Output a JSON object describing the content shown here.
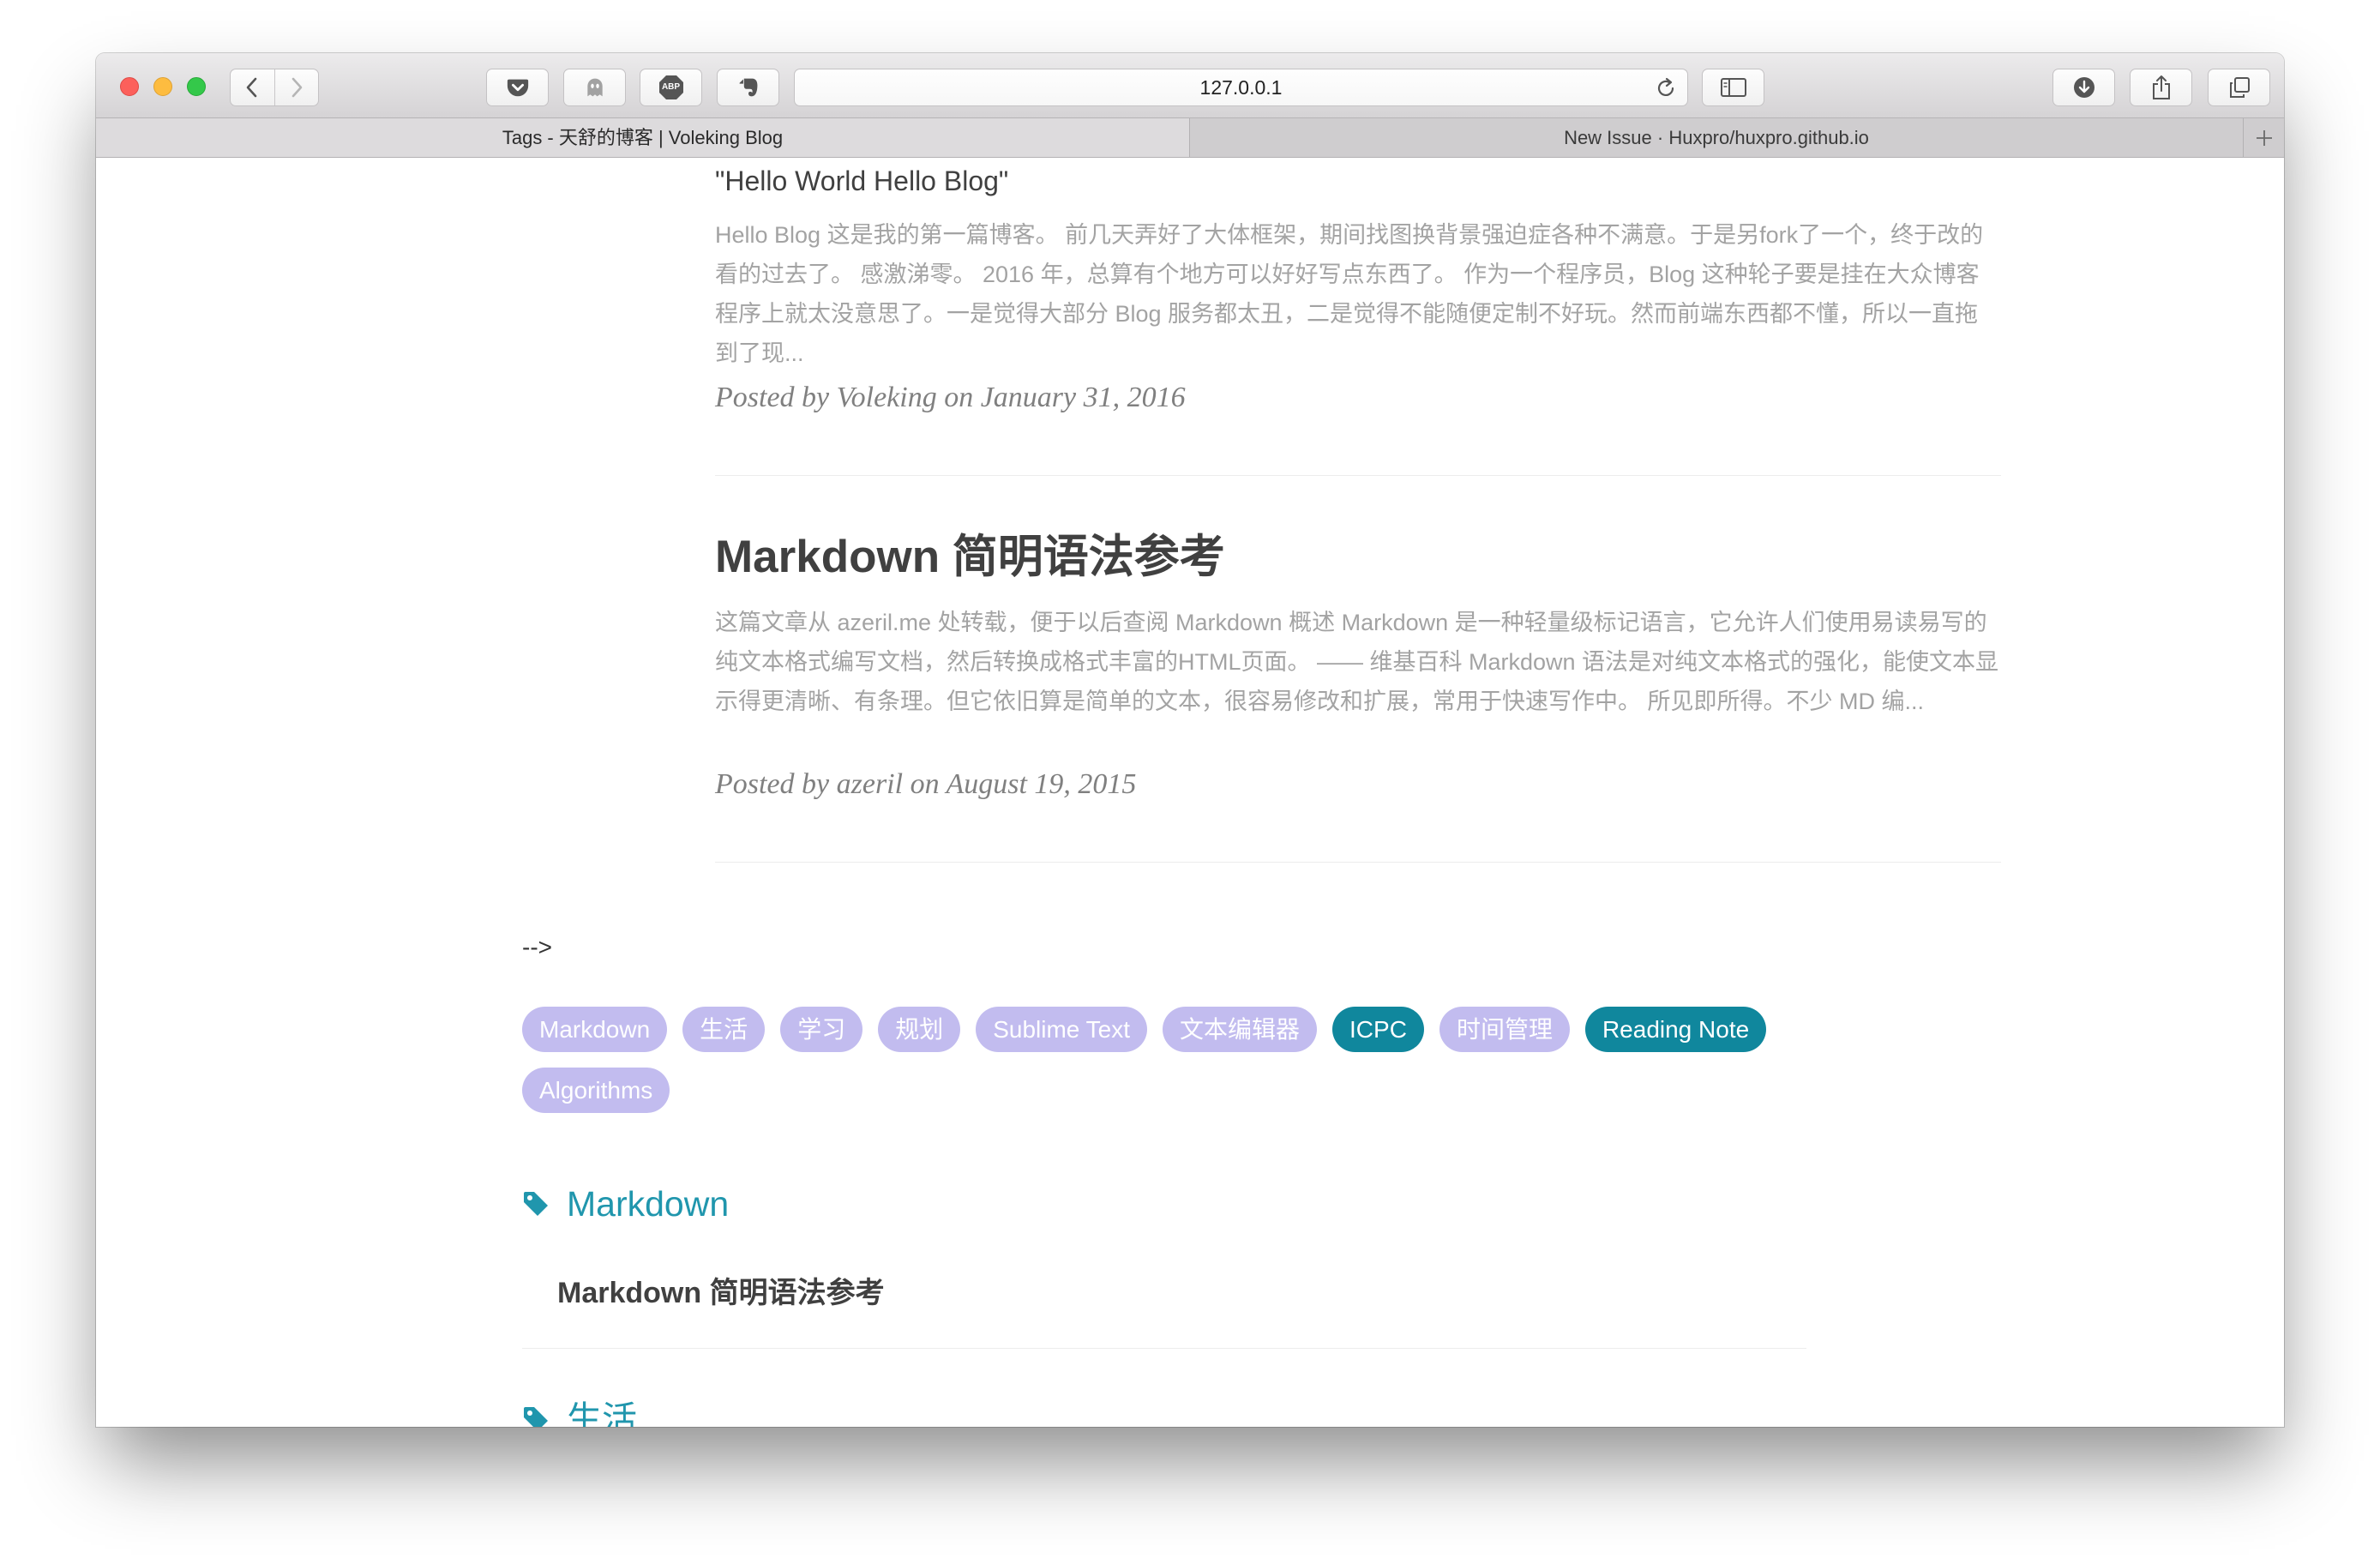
{
  "browser": {
    "address_text": "127.0.0.1",
    "tabs": [
      {
        "title": "Tags - 天舒的博客 | Voleking Blog",
        "active": true
      },
      {
        "title": "New Issue · Huxpro/huxpro.github.io",
        "active": false
      }
    ],
    "adblock_badge": "ABP",
    "icons": {
      "window_controls": [
        "close-icon",
        "minimize-icon",
        "zoom-icon"
      ],
      "navigation": [
        "back-icon",
        "forward-icon"
      ],
      "extensions": [
        "pocket-icon",
        "ghostery-icon",
        "adblock-icon",
        "evernote-icon"
      ],
      "address_bar": [
        "reload-icon"
      ],
      "toolbar_right": [
        "sidebar-icon",
        "download-icon",
        "share-icon",
        "tabs-overview-icon"
      ],
      "tab_bar": [
        "new-tab-plus-icon"
      ]
    }
  },
  "posts": [
    {
      "title": "\"Hello World Hello Blog\"",
      "excerpt": "Hello Blog 这是我的第一篇博客。 前几天弄好了大体框架，期间找图换背景强迫症各种不满意。于是另fork了一个，终于改的看的过去了。 感激涕零。 2016 年，总算有个地方可以好好写点东西了。 作为一个程序员，Blog 这种轮子要是挂在大众博客程序上就太没意思了。一是觉得大部分 Blog 服务都太丑，二是觉得不能随便定制不好玩。然而前端东西都不懂，所以一直拖到了现...",
      "meta": "Posted by Voleking on January 31, 2016"
    },
    {
      "title": "Markdown 简明语法参考",
      "excerpt": "这篇文章从 azeril.me 处转载，便于以后查阅 Markdown 概述 Markdown 是一种轻量级标记语言，它允许人们使用易读易写的纯文本格式编写文档，然后转换成格式丰富的HTML页面。 —— 维基百科 Markdown 语法是对纯文本格式的强化，能使文本显示得更清晰、有条理。但它依旧算是简单的文本，很容易修改和扩展，常用于快速写作中。 所见即所得。不少 MD 编...",
      "meta": "Posted by azeril on August 19, 2015"
    }
  ],
  "stray_text": "-->",
  "tags": [
    {
      "label": "Markdown",
      "highlighted": false
    },
    {
      "label": "生活",
      "highlighted": false
    },
    {
      "label": "学习",
      "highlighted": false
    },
    {
      "label": "规划",
      "highlighted": false
    },
    {
      "label": "Sublime Text",
      "highlighted": false
    },
    {
      "label": "文本编辑器",
      "highlighted": false
    },
    {
      "label": "ICPC",
      "highlighted": true
    },
    {
      "label": "时间管理",
      "highlighted": false
    },
    {
      "label": "Reading Note",
      "highlighted": true
    },
    {
      "label": "Algorithms",
      "highlighted": false
    }
  ],
  "tag_sections": [
    {
      "name": "Markdown",
      "icon": "tag-icon",
      "posts": [
        {
          "title": "Markdown 简明语法参考"
        }
      ]
    },
    {
      "name": "生活",
      "icon": "tag-icon"
    }
  ],
  "colors": {
    "accent": "#2096ad",
    "tag_light": "#c2bcef",
    "tag_dark": "#10879d",
    "title_text": "#404040",
    "excerpt_text": "#a3a3a3",
    "meta_text": "#808080"
  }
}
